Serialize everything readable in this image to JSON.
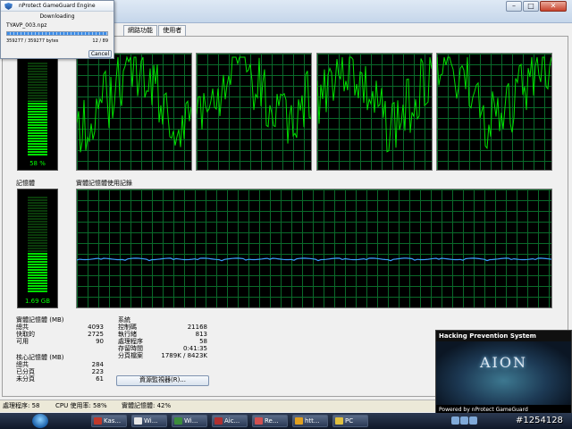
{
  "window": {
    "tabs": [
      "網路功能",
      "使用者"
    ],
    "titlebar_controls": [
      "–",
      "□",
      "✕"
    ]
  },
  "cpu": {
    "usage_label": "58 %",
    "usage_level": 58,
    "history_title_fragment": "錄",
    "line_color": "#00e000"
  },
  "memory": {
    "section_label": "記憶體",
    "usage_label": "1.69 GB",
    "usage_level": 42,
    "history_title": "實體記憶體使用記錄",
    "line_color": "#3aa0ff"
  },
  "physical_memory": {
    "title": "實體記憶體 (MB)",
    "rows": [
      {
        "label": "總共",
        "value": "4093"
      },
      {
        "label": "快取的",
        "value": "2725"
      },
      {
        "label": "可用",
        "value": "90"
      }
    ]
  },
  "kernel_memory": {
    "title": "核心記憶體 (MB)",
    "rows": [
      {
        "label": "總共",
        "value": "284"
      },
      {
        "label": "已分頁",
        "value": "223"
      },
      {
        "label": "未分頁",
        "value": "61"
      }
    ]
  },
  "system": {
    "title": "系統",
    "rows": [
      {
        "label": "控制碼",
        "value": "21168"
      },
      {
        "label": "執行緒",
        "value": "813"
      },
      {
        "label": "處理程序",
        "value": "58"
      },
      {
        "label": "存留時間",
        "value": "0:41:35"
      },
      {
        "label": "分頁檔案",
        "value": "1789K / 8423K"
      }
    ]
  },
  "resource_monitor_button": "資源監視器(R)...",
  "status_bar": {
    "processes": "處理程序: 58",
    "cpu": "CPU 使用率: 58%",
    "memory": "實體記憶體: 42%"
  },
  "download_dialog": {
    "title": "nProtect GameGuard Engine",
    "status": "Downloading",
    "filename": "TYAVP_003.npz",
    "bytes": "359277 / 359277 bytes",
    "count": "12 / 89",
    "progress": 100,
    "cancel_label": "Cancel"
  },
  "hacking_overlay": {
    "title": "Hacking Prevention System",
    "logo_text": "AION",
    "footer": "Powered by  nProtect GameGuard"
  },
  "taskbar": {
    "items": [
      {
        "label": "Kas...",
        "color": "#c0392b"
      },
      {
        "label": "Wi...",
        "color": "#e6e6e6"
      },
      {
        "label": "Wi...",
        "color": "#3c8d3c"
      },
      {
        "label": "Aic...",
        "color": "#b03030"
      },
      {
        "label": "Re...",
        "color": "#d05050"
      },
      {
        "label": "htt...",
        "color": "#e0a020"
      },
      {
        "label": "PC",
        "color": "#e0c040"
      }
    ]
  },
  "watermark": "#1254128"
}
